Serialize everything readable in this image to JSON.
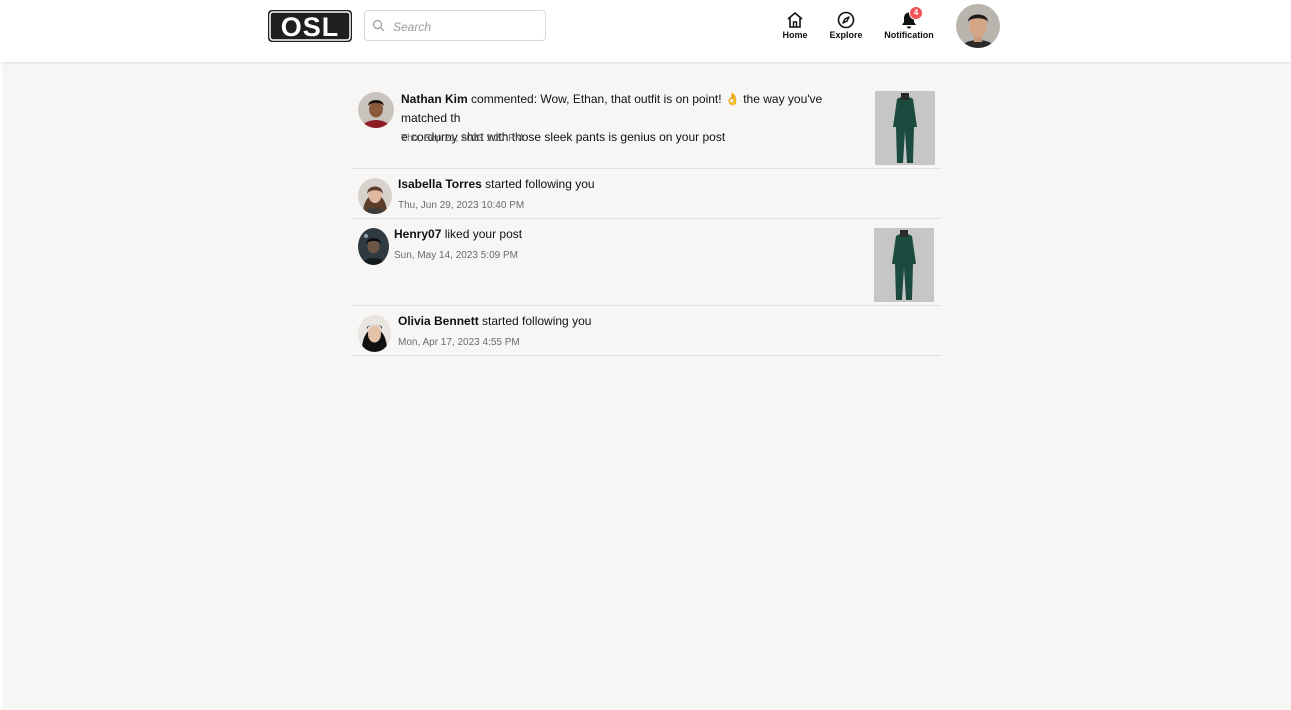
{
  "header": {
    "logo_text": "OSL",
    "search": {
      "placeholder": "Search",
      "value": ""
    },
    "nav": [
      {
        "label": "Home",
        "icon": "home-icon"
      },
      {
        "label": "Explore",
        "icon": "compass-icon"
      },
      {
        "label": "Notification",
        "icon": "bell-icon",
        "badge": "4"
      }
    ],
    "accent_badge_color": "#f25555"
  },
  "notifications": [
    {
      "user": "Nathan Kim",
      "action_line1": " commented: Wow, Ethan, that outfit is on point! 👌 the way you've matched th",
      "action_line2": "e corduroy shirt with those sleek pants is genius on your post",
      "time": "Thu, Sep 21, 2023 1:27 PM",
      "has_thumbnail": true
    },
    {
      "user": "Isabella Torres",
      "action": " started following you",
      "time": "Thu, Jun 29, 2023 10:40 PM",
      "has_thumbnail": false
    },
    {
      "user": "Henry07",
      "action": " liked your post",
      "time": "Sun, May 14, 2023 5:09 PM",
      "has_thumbnail": true
    },
    {
      "user": "Olivia Bennett",
      "action": " started following you",
      "time": "Mon, Apr 17, 2023 4:55 PM",
      "has_thumbnail": false
    }
  ]
}
